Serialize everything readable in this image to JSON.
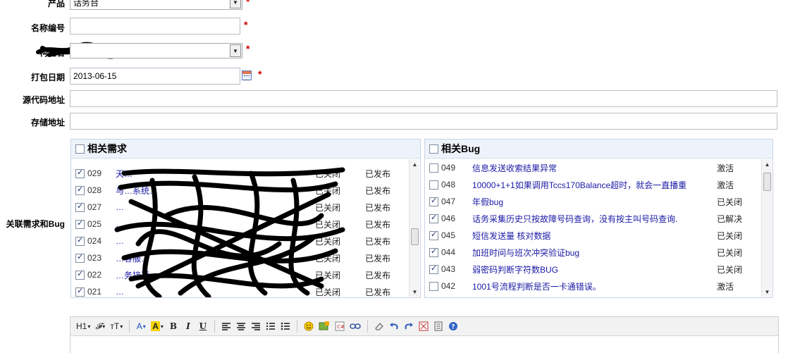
{
  "form": {
    "product": {
      "label": "产品",
      "value": "话务台"
    },
    "name_code": {
      "label": "名称编号",
      "value": ""
    },
    "build": {
      "label": "构建名",
      "value": ""
    },
    "pack_date": {
      "label": "打包日期",
      "value": "2013-06-15"
    },
    "source_url": {
      "label": "源代码地址",
      "value": ""
    },
    "storage_url": {
      "label": "存储地址",
      "value": ""
    },
    "relate": {
      "label": "关联需求和Bug"
    },
    "required_mark": "*"
  },
  "stories_panel": {
    "title": "相关需求",
    "rows": [
      {
        "id": "029",
        "checked": true,
        "title": "天…",
        "status1": "已关闭",
        "status2": "已发布"
      },
      {
        "id": "028",
        "checked": true,
        "title": "与…系统…",
        "status1": "已关闭",
        "status2": "已发布"
      },
      {
        "id": "027",
        "checked": true,
        "title": "…",
        "status1": "已关闭",
        "status2": "已发布"
      },
      {
        "id": "025",
        "checked": true,
        "title": "…",
        "status1": "已关闭",
        "status2": "已发布"
      },
      {
        "id": "024",
        "checked": true,
        "title": "…",
        "status1": "已关闭",
        "status2": "已发布"
      },
      {
        "id": "023",
        "checked": true,
        "title": "…客服…",
        "status1": "已关闭",
        "status2": "已发布"
      },
      {
        "id": "022",
        "checked": true,
        "title": "…务接通…",
        "status1": "已关闭",
        "status2": "已发布"
      },
      {
        "id": "021",
        "checked": true,
        "title": "…",
        "status1": "已关闭",
        "status2": "已发布"
      }
    ]
  },
  "bugs_panel": {
    "title": "相关Bug",
    "rows": [
      {
        "id": "049",
        "checked": false,
        "title": "信息发送收索结果异常",
        "status": "激活"
      },
      {
        "id": "048",
        "checked": false,
        "title": "10000+1+1如果调用Tccs170Balance超时，就会一直播重",
        "status": "激活"
      },
      {
        "id": "047",
        "checked": true,
        "title": "年假bug",
        "status": "已关闭"
      },
      {
        "id": "046",
        "checked": true,
        "title": "话务采集历史只按故障号码查询，没有按主叫号码查询.",
        "status": "已解决"
      },
      {
        "id": "045",
        "checked": true,
        "title": "短信发送量 核对数据",
        "status": "已关闭"
      },
      {
        "id": "044",
        "checked": true,
        "title": "加班时间与班次冲突验证bug",
        "status": "已关闭"
      },
      {
        "id": "043",
        "checked": true,
        "title": "弱密码判断字符数BUG",
        "status": "已关闭"
      },
      {
        "id": "042",
        "checked": false,
        "title": "1001号流程判断是否一卡通错误。",
        "status": "激活"
      }
    ]
  },
  "toolbar": {
    "heading": "H1",
    "font": "𝓕",
    "size": "тT",
    "font_color": "A",
    "highlight": "A",
    "bold": "B",
    "italic": "I",
    "underline": "U"
  }
}
